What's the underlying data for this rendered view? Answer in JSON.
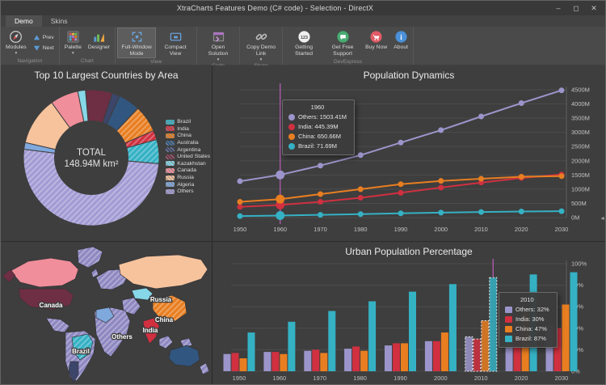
{
  "window": {
    "title": "XtraCharts Features Demo (C# code) - Selection - DirectX",
    "controls": {
      "minimize": "–",
      "maximize": "◻",
      "close": "✕"
    }
  },
  "tabs": [
    {
      "label": "Demo",
      "active": true
    },
    {
      "label": "Skins",
      "active": false
    }
  ],
  "ribbon": {
    "dropdown_glyph": "▾",
    "groups": [
      {
        "label": "Navigation",
        "items": [
          {
            "type": "big",
            "label": "Modules",
            "icon": "compass-icon",
            "dropdown": true
          },
          {
            "type": "small-stack",
            "buttons": [
              {
                "label": "Prev",
                "icon": "triangle-up-icon"
              },
              {
                "label": "Next",
                "icon": "triangle-down-icon"
              }
            ]
          }
        ]
      },
      {
        "label": "Chart",
        "items": [
          {
            "type": "big",
            "label": "Palette",
            "icon": "palette-grid-icon",
            "dropdown": true
          },
          {
            "type": "big",
            "label": "Designer",
            "icon": "chart-designer-icon"
          }
        ]
      },
      {
        "label": "View",
        "items": [
          {
            "type": "big",
            "label": "Full-Window Mode",
            "icon": "full-window-icon",
            "selected": true
          },
          {
            "type": "big",
            "label": "Compact View",
            "icon": "compact-view-icon"
          }
        ]
      },
      {
        "label": "Code",
        "items": [
          {
            "type": "big",
            "label": "Open Solution",
            "icon": "open-solution-icon",
            "dropdown": true
          }
        ]
      },
      {
        "label": "Share",
        "items": [
          {
            "type": "big",
            "label": "Copy Demo Link",
            "icon": "link-icon",
            "dropdown": true
          }
        ]
      },
      {
        "label": "DevExpress",
        "items": [
          {
            "type": "big",
            "label": "Getting Started",
            "icon": "getting-started-icon"
          },
          {
            "type": "big",
            "label": "Get Free Support",
            "icon": "support-icon"
          },
          {
            "type": "big",
            "label": "Buy Now",
            "icon": "buy-now-icon"
          },
          {
            "type": "big",
            "label": "About",
            "icon": "about-icon"
          }
        ]
      }
    ]
  },
  "colors": {
    "panel_bg": "#3e3e3e",
    "crosshair": "#bd5dbd",
    "grid": "#4c4c4c",
    "axis_text": "#c2c2c2",
    "selection_outline": "#efefef"
  },
  "chart_data": [
    {
      "type": "pie",
      "title": "Top 10 Largest Countries by Area",
      "center_label": "TOTAL",
      "center_value": "148.94M km²",
      "categories": [
        "Brazil",
        "India",
        "China",
        "Australia",
        "Argentina",
        "United States",
        "Kazakhstan",
        "Canada",
        "Russia",
        "Algeria",
        "Others"
      ],
      "values": [
        8.52,
        3.29,
        9.6,
        7.69,
        2.78,
        9.53,
        2.72,
        9.98,
        17.1,
        2.38,
        75.35
      ],
      "colors": [
        "#35b1c4",
        "#d03040",
        "#e87e21",
        "#31567f",
        "#3c466b",
        "#6e2e44",
        "#86d7e8",
        "#f18e9b",
        "#f7c39c",
        "#7fa8dd",
        "#a29bd4"
      ],
      "selected": [
        true,
        true,
        true,
        false,
        false,
        false,
        false,
        false,
        false,
        false,
        true
      ],
      "legend_position": "right"
    },
    {
      "type": "line",
      "title": "Population Dynamics",
      "x": [
        1950,
        1960,
        1970,
        1980,
        1990,
        2000,
        2010,
        2020,
        2030
      ],
      "series": [
        {
          "name": "Others",
          "color": "#9b95cb",
          "values": [
            1280,
            1503.41,
            1830,
            2200,
            2640,
            3080,
            3560,
            4030,
            4480
          ]
        },
        {
          "name": "India",
          "color": "#d03040",
          "values": [
            376,
            445.39,
            555,
            699,
            873,
            1057,
            1234,
            1396,
            1515
          ]
        },
        {
          "name": "China",
          "color": "#e87e21",
          "values": [
            554,
            650.66,
            827,
            1000,
            1176,
            1291,
            1368,
            1439,
            1460
          ]
        },
        {
          "name": "Brazil",
          "color": "#35b1c4",
          "values": [
            54,
            71.69,
            96,
            122,
            150,
            175,
            196,
            213,
            224
          ]
        }
      ],
      "ylim": [
        0,
        4500
      ],
      "ytick_step": 500,
      "yunit": "M",
      "axis_side": "right",
      "grid": true,
      "crosshair_x": 1960,
      "tooltip": {
        "header": "1960",
        "rows": [
          {
            "name": "Others",
            "value": "1503.41M"
          },
          {
            "name": "India",
            "value": "445.39M"
          },
          {
            "name": "China",
            "value": "650.66M"
          },
          {
            "name": "Brazil",
            "value": "71.69M"
          }
        ]
      }
    },
    {
      "type": "bar",
      "title": "Urban Population Percentage",
      "categories": [
        1950,
        1960,
        1970,
        1980,
        1990,
        2000,
        2010,
        2020,
        2030
      ],
      "series": [
        {
          "name": "Others",
          "color": "#9b95cb",
          "values": [
            16,
            18,
            19,
            21,
            24,
            28,
            32,
            35,
            43
          ]
        },
        {
          "name": "India",
          "color": "#d03040",
          "values": [
            17,
            18,
            20,
            23,
            26,
            28,
            30,
            35,
            40
          ]
        },
        {
          "name": "China",
          "color": "#e87e21",
          "values": [
            12,
            16,
            17,
            19,
            26,
            36,
            47,
            56,
            62
          ]
        },
        {
          "name": "Brazil",
          "color": "#35b1c4",
          "values": [
            36,
            46,
            56,
            65,
            74,
            81,
            87,
            90,
            92
          ]
        }
      ],
      "ylim": [
        0,
        100
      ],
      "ytick_step": 20,
      "yunit": "%",
      "axis_side": "right",
      "grid": true,
      "selected_category": 2010,
      "tooltip": {
        "header": "2010",
        "rows": [
          {
            "name": "Others",
            "value": "32%"
          },
          {
            "name": "India",
            "value": "30%"
          },
          {
            "name": "China",
            "value": "47%"
          },
          {
            "name": "Brazil",
            "value": "87%"
          }
        ]
      }
    },
    {
      "type": "map",
      "region_colors": {
        "others": "#8e88c1",
        "canada": "#f18e9b",
        "united-states": "#6e2e44",
        "russia": "#f7c39c",
        "kazakhstan": "#86d7e8",
        "china": "#e87e21",
        "india": "#d03040",
        "brazil": "#35b1c4",
        "argentina": "#3c466b",
        "australia": "#31567f",
        "algeria": "#7fa8dd"
      },
      "hatched_regions": [
        "others",
        "china",
        "brazil"
      ],
      "labels": [
        {
          "text": "Canada",
          "x": 62,
          "y": 81
        },
        {
          "text": "Russia",
          "x": 198,
          "y": 74
        },
        {
          "text": "China",
          "x": 202,
          "y": 99
        },
        {
          "text": "India",
          "x": 185,
          "y": 112
        },
        {
          "text": "Others",
          "x": 150,
          "y": 120
        },
        {
          "text": "Brazil",
          "x": 99,
          "y": 138
        }
      ]
    }
  ]
}
